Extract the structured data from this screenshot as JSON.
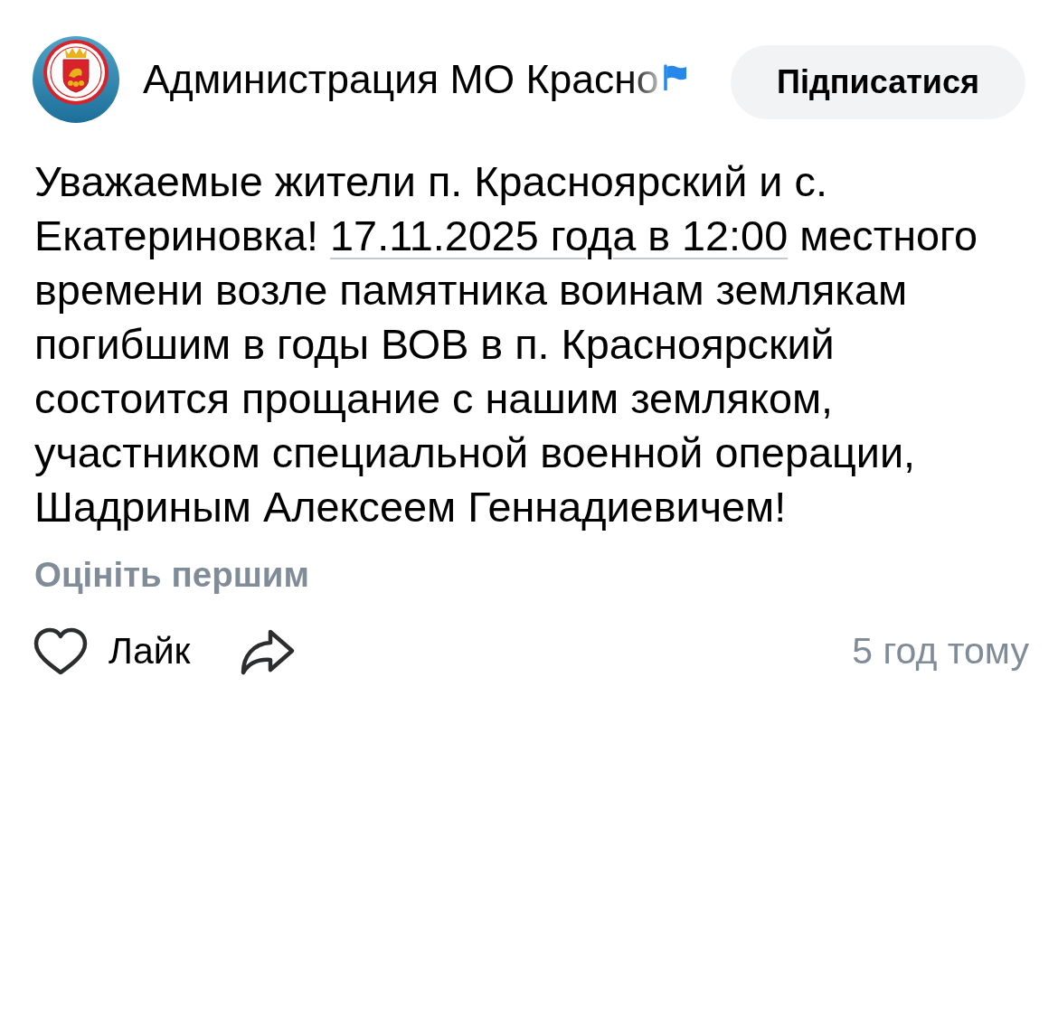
{
  "header": {
    "author_name": "Администрация МО Красно",
    "subscribe_button": "Підписатися"
  },
  "post_text": [
    {
      "kind": "plain",
      "text": "Уважаемые жители п. Красноярский и с. Екатериновка! "
    },
    {
      "kind": "date_link",
      "text": "17.11.2025 года в 12:00"
    },
    {
      "kind": "plain",
      "text": " местного времени возле памятника воинам землякам погибшим в годы ВОВ в п. Красноярский состоится прощание с нашим земляком, участником специальной военной операции, Шадриным Алексеем Геннадиевичем!"
    }
  ],
  "rating_prompt": "Оцініть першим",
  "actions": [
    {
      "kind": "like",
      "label": "Лайк"
    },
    {
      "kind": "share"
    }
  ],
  "time": "5 год тому"
}
